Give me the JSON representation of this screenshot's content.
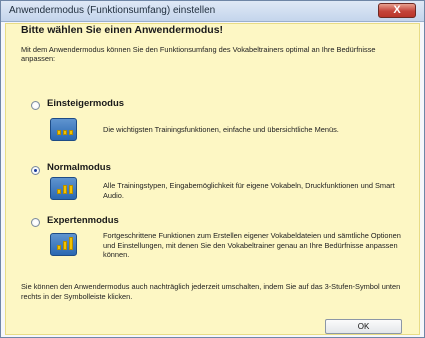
{
  "window": {
    "title": "Anwendermodus (Funktionsumfang) einstellen",
    "close_label": "X"
  },
  "dialog": {
    "heading": "Bitte wählen Sie einen Anwendermodus!",
    "intro": "Mit dem Anwendermodus können Sie den Funktionsumfang des Vokabeltrainers optimal an Ihre Bedürfnisse anpassen:",
    "modes": [
      {
        "label": "Einsteigermodus",
        "selected": false,
        "description": "Die wichtigsten Trainingsfunktionen, einfache und übersichtliche Menüs."
      },
      {
        "label": "Normalmodus",
        "selected": true,
        "description": "Alle Trainingstypen, Eingabemöglichkeit für eigene Vokabeln, Druckfunktionen und Smart Audio."
      },
      {
        "label": "Expertenmodus",
        "selected": false,
        "description": "Fortgeschrittene Funktionen zum Erstellen eigener Vokabeldateien und sämtliche Optionen und Einstellungen, mit denen Sie den Vokabeltrainer genau an Ihre Bedürfnisse anpassen können."
      }
    ],
    "footer": "Sie können den Anwendermodus auch nachträglich jederzeit umschalten, indem Sie auf das 3-Stufen-Symbol unten rechts in der Symbolleiste klicken.",
    "ok_label": "OK"
  },
  "icons": {
    "radio": "radio-button",
    "mode": "level-bars-icon",
    "close": "close-icon"
  },
  "colors": {
    "panel_bg": "#fdf7c4",
    "icon_blue": "#2a68b2",
    "bar_yellow": "#f2c200",
    "close_red": "#c4443a"
  }
}
